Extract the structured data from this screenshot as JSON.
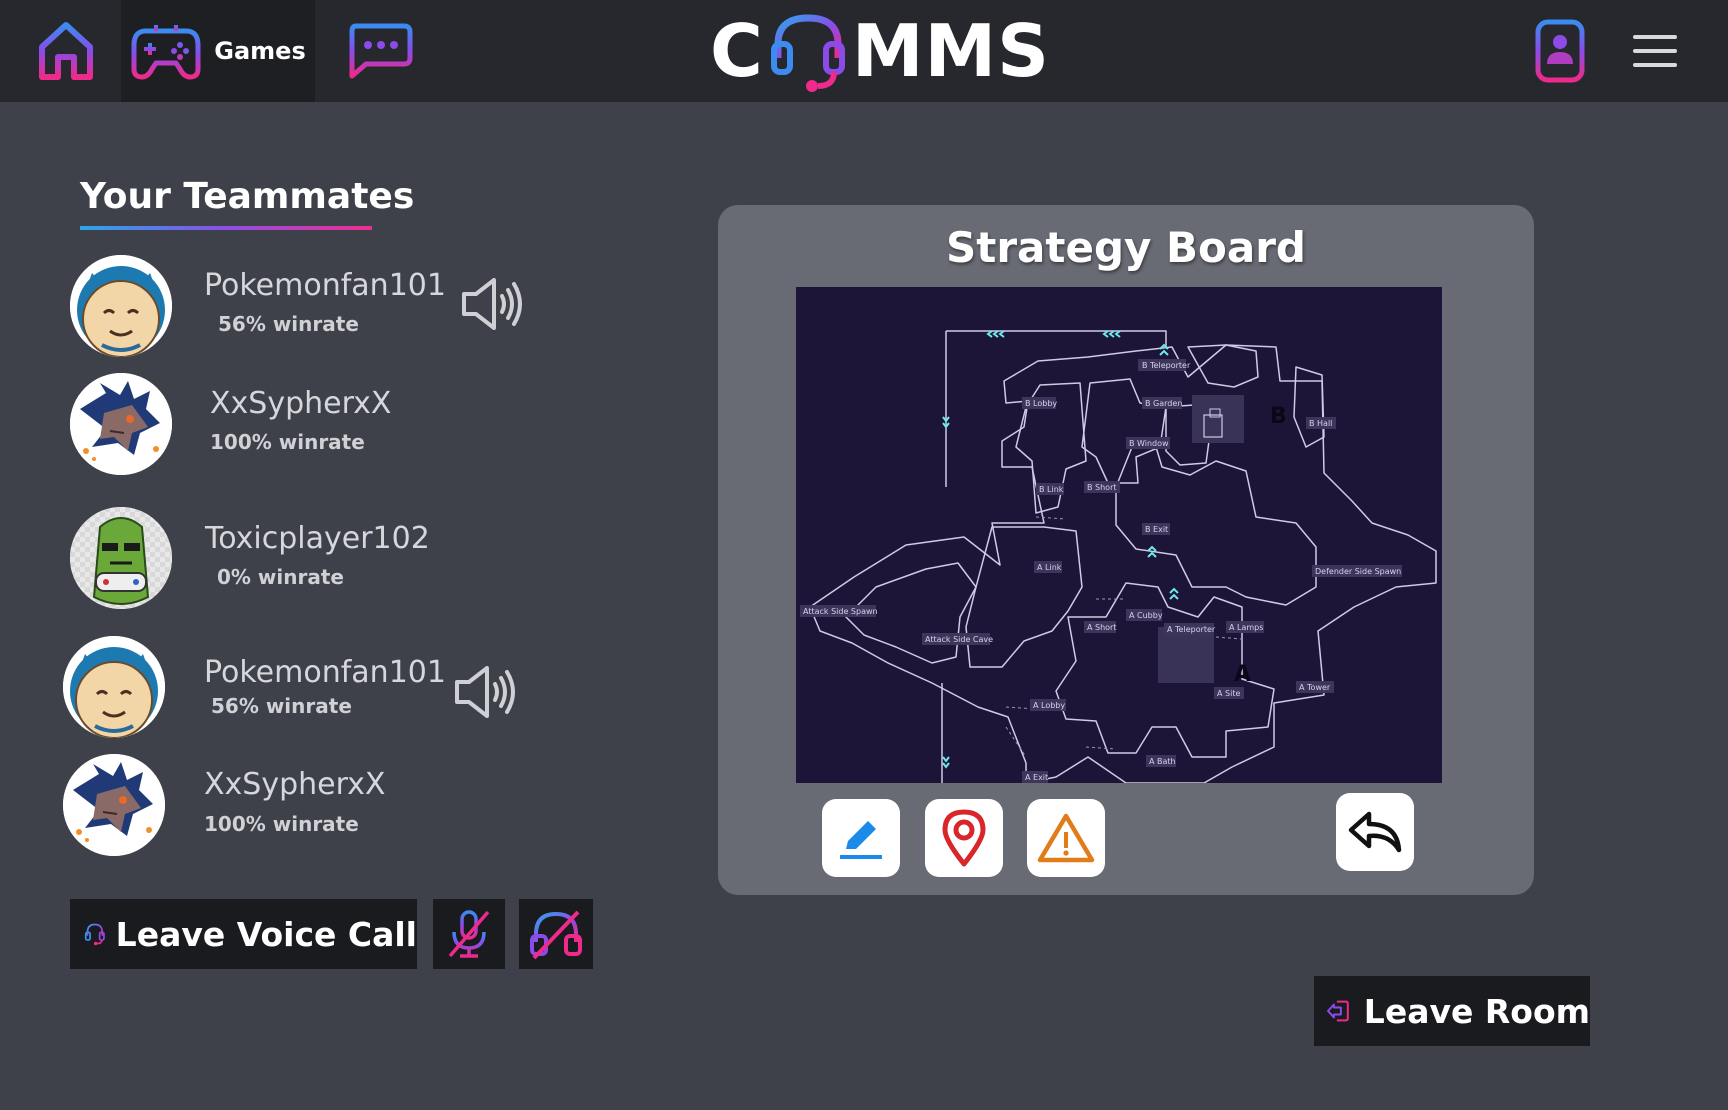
{
  "app": {
    "logo_left": "C",
    "logo_right": "MMS"
  },
  "nav": {
    "home_icon": "home-icon",
    "games_label": "Games",
    "chat_icon": "chat-icon",
    "profile_icon": "profile-icon",
    "menu_icon": "hamburger-menu-icon"
  },
  "teammates": {
    "title": "Your Teammates",
    "list": [
      {
        "name": "Pokemonfan101",
        "winrate": "56% winrate",
        "avatar": "snorlax-avatar",
        "speaking": true
      },
      {
        "name": "XxSypherxX",
        "winrate": "100% winrate",
        "avatar": "dragon-avatar",
        "speaking": false
      },
      {
        "name": "Toxicplayer102",
        "winrate": "0% winrate",
        "avatar": "pickle-gamer-avatar",
        "speaking": false
      },
      {
        "name": "Pokemonfan101",
        "winrate": "56% winrate",
        "avatar": "snorlax-avatar",
        "speaking": true
      },
      {
        "name": "XxSypherxX",
        "winrate": "100% winrate",
        "avatar": "dragon-avatar",
        "speaking": false
      }
    ]
  },
  "voice": {
    "leave_label": "Leave Voice Call",
    "mute_icon": "mic-off-icon",
    "deafen_icon": "headphones-off-icon"
  },
  "board": {
    "title": "Strategy Board",
    "map_labels": {
      "b_teleporter": "B Teleporter",
      "b_lobby": "B Lobby",
      "b_garden": "B Garden",
      "b_hall": "B Hall",
      "b_window": "B Window",
      "b_link": "B Link",
      "b_short": "B Short",
      "b_exit": "B Exit",
      "a_link": "A Link",
      "defender_spawn": "Defender Side Spawn",
      "attack_spawn": "Attack Side Spawn",
      "attack_cave": "Attack Side Cave",
      "a_short": "A Short",
      "a_cubby": "A Cubby",
      "a_teleporter": "A Teleporter",
      "a_lamps": "A Lamps",
      "a_site": "A Site",
      "a_tower": "A Tower",
      "a_lobby": "A Lobby",
      "a_bath": "A Bath",
      "a_exit": "A Exit",
      "site_a": "A",
      "site_b": "B"
    },
    "tools": [
      "pencil-icon",
      "map-pin-icon",
      "warning-icon"
    ],
    "undo_icon": "undo-arrow-icon"
  },
  "room": {
    "leave_label": "Leave Room"
  }
}
